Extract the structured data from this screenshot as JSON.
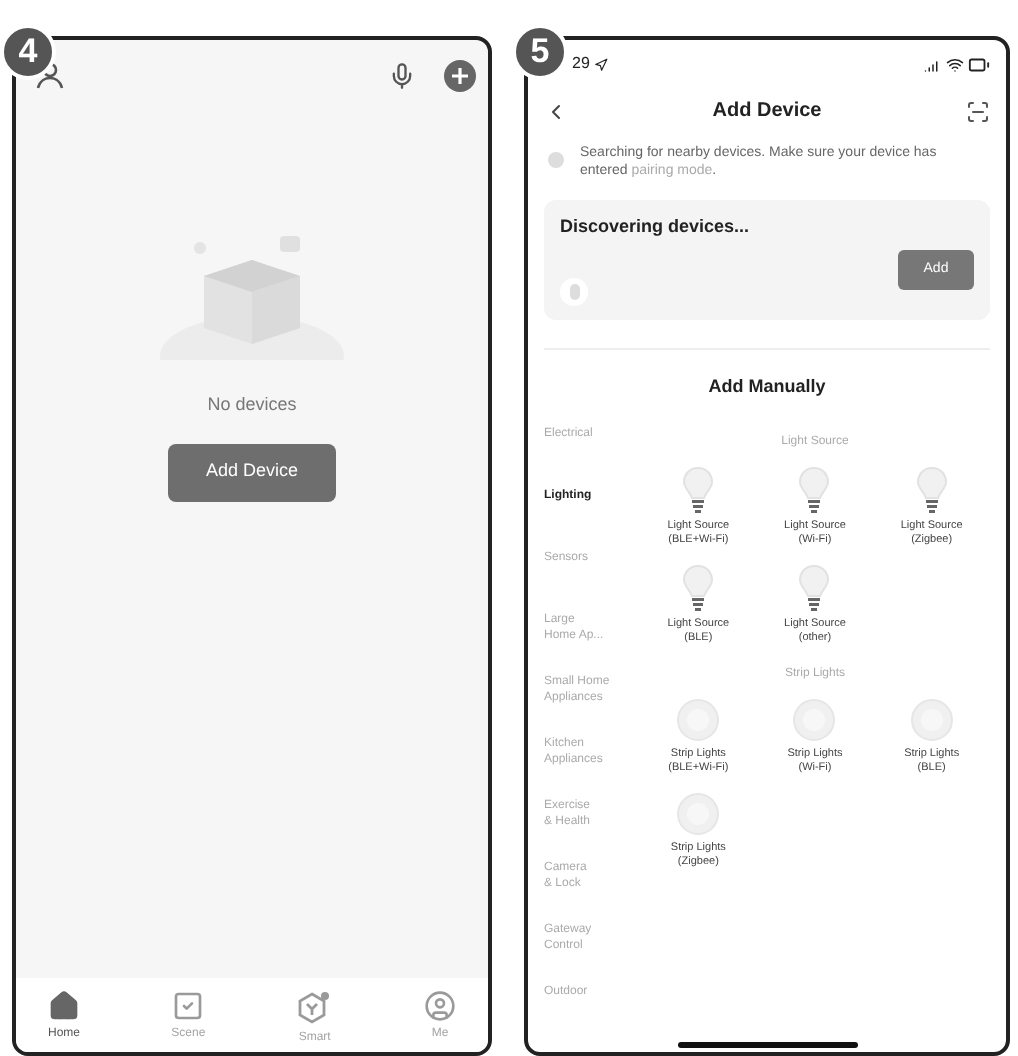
{
  "home_screen": {
    "step": "4",
    "empty_text": "No devices",
    "add_button": "Add Device",
    "tabs": [
      {
        "label": "Home",
        "selected": true
      },
      {
        "label": "Scene",
        "selected": false
      },
      {
        "label": "Smart",
        "selected": false
      },
      {
        "label": "Me",
        "selected": false
      }
    ]
  },
  "add_device_screen": {
    "step": "5",
    "time": "29",
    "title": "Add Device",
    "search_text": "Searching for nearby devices. Make sure your device has entered",
    "search_link": "pairing mode",
    "search_end": ".",
    "discovering": "Discovering devices...",
    "add_button": "Add",
    "section_title": "Add Manually",
    "categories": [
      {
        "label": "Electrical",
        "selected": false
      },
      {
        "label": "Lighting",
        "selected": true
      },
      {
        "label": "Sensors",
        "selected": false
      },
      {
        "label": "Large\nHome Ap...",
        "selected": false
      },
      {
        "label": "Small Home\nAppliances",
        "selected": false
      },
      {
        "label": "Kitchen\nAppliances",
        "selected": false
      },
      {
        "label": "Exercise\n& Health",
        "selected": false
      },
      {
        "label": "Camera\n& Lock",
        "selected": false
      },
      {
        "label": "Gateway\nControl",
        "selected": false
      },
      {
        "label": "Outdoor",
        "selected": false
      }
    ],
    "groups": [
      {
        "title": "Light Source",
        "items": [
          {
            "kind": "bulb",
            "name": "Light Source",
            "variant": "(BLE+Wi-Fi)"
          },
          {
            "kind": "bulb",
            "name": "Light Source",
            "variant": "(Wi-Fi)"
          },
          {
            "kind": "bulb",
            "name": "Light Source",
            "variant": "(Zigbee)"
          },
          {
            "kind": "bulb",
            "name": "Light Source",
            "variant": "(BLE)"
          },
          {
            "kind": "bulb",
            "name": "Light Source",
            "variant": "(other)"
          }
        ]
      },
      {
        "title": "Strip Lights",
        "items": [
          {
            "kind": "strip",
            "name": "Strip Lights",
            "variant": "(BLE+Wi-Fi)"
          },
          {
            "kind": "strip",
            "name": "Strip Lights",
            "variant": "(Wi-Fi)"
          },
          {
            "kind": "strip",
            "name": "Strip Lights",
            "variant": "(BLE)"
          },
          {
            "kind": "strip",
            "name": "Strip Lights",
            "variant": "(Zigbee)"
          }
        ]
      }
    ]
  }
}
